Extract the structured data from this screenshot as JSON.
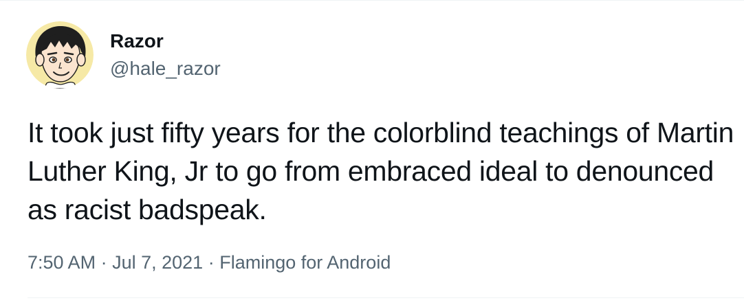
{
  "author": {
    "name": "Razor",
    "handle": "@hale_razor",
    "avatar_icon": "cartoon-face-avatar"
  },
  "tweet": {
    "text": "It took just fifty years for the colorblind teachings of Martin Luther King, Jr to go from embraced ideal to denounced as racist badspeak.",
    "time": "7:50 AM",
    "separator": "·",
    "date": "Jul 7, 2021",
    "source": "Flamingo for Android"
  },
  "colors": {
    "text_primary": "#0f1419",
    "text_secondary": "#536471",
    "divider": "#eff3f4",
    "avatar_background": "#f6e9a6"
  }
}
